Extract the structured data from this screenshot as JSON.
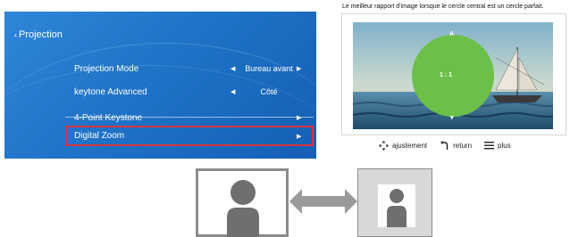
{
  "osd": {
    "title": "Projection",
    "items": [
      {
        "label": "Projection Mode",
        "value": "Bureau avant",
        "has_left_arrow": true,
        "has_right_arrow": true
      },
      {
        "label": "keytone Advanced",
        "value": "Côté",
        "has_left_arrow": true,
        "has_right_arrow": false
      },
      {
        "label": "4-Point Keystone",
        "value": "",
        "has_left_arrow": false,
        "has_right_arrow": true
      },
      {
        "label": "Digital Zoom",
        "value": "",
        "has_left_arrow": false,
        "has_right_arrow": true,
        "selected": true
      }
    ]
  },
  "preview": {
    "caption": "Le meilleur rapport d'image  lorsque le cercle central est un cercle parfait.",
    "ratio_label": "1 : 1",
    "legend": {
      "adjust": "ajustement",
      "return": "return",
      "more": "plus"
    }
  },
  "colors": {
    "osd_bg": "#1f73c8",
    "selection_border": "#d7343f",
    "circle": "#6cc04a"
  },
  "icons": [
    "back-icon",
    "arrow-left-icon",
    "arrow-right-icon",
    "move-icon",
    "return-icon",
    "menu-icon",
    "double-arrow-icon",
    "person-icon"
  ]
}
